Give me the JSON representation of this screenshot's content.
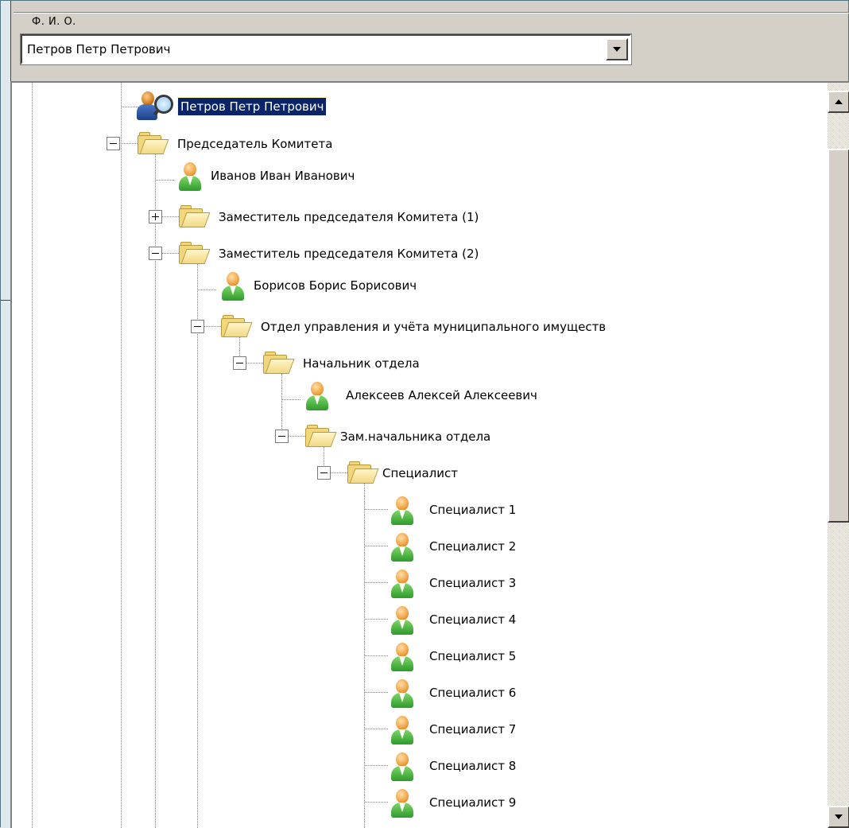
{
  "fio_group": {
    "legend": "Ф. И. О.",
    "selected_person": "Петров Петр Петрович"
  },
  "tree": {
    "root": {
      "label": "Петров Петр Петрович",
      "icon": "user-search-icon",
      "selected": true
    },
    "chairman_folder": {
      "label": "Председатель Комитета",
      "icon": "folder-open-icon",
      "expanded": true
    },
    "chairman_person": {
      "label": "Иванов Иван Иванович",
      "icon": "user-icon"
    },
    "deputy1_folder": {
      "label": "Заместитель председателя Комитета (1)",
      "icon": "folder-icon",
      "expanded": false
    },
    "deputy2_folder": {
      "label": "Заместитель председателя Комитета (2)",
      "icon": "folder-open-icon",
      "expanded": true
    },
    "deputy2_person": {
      "label": "Борисов Борис Борисович",
      "icon": "user-icon"
    },
    "department_folder": {
      "label": "Отдел управления и учёта муниципального имуществ",
      "icon": "folder-open-icon",
      "expanded": true
    },
    "head_folder": {
      "label": "Начальник отдела",
      "icon": "folder-open-icon",
      "expanded": true
    },
    "head_person": {
      "label": "Алексеев Алексей Алексеевич",
      "icon": "user-icon"
    },
    "deputy_head_folder": {
      "label": "Зам.начальника отдела",
      "icon": "folder-open-icon",
      "expanded": true
    },
    "specialist_folder": {
      "label": "Специалист",
      "icon": "folder-open-icon",
      "expanded": true
    },
    "specialists": [
      "Специалист 1",
      "Специалист 2",
      "Специалист 3",
      "Специалист 4",
      "Специалист 5",
      "Специалист 6",
      "Специалист 7",
      "Специалист 8",
      "Специалист 9"
    ]
  }
}
